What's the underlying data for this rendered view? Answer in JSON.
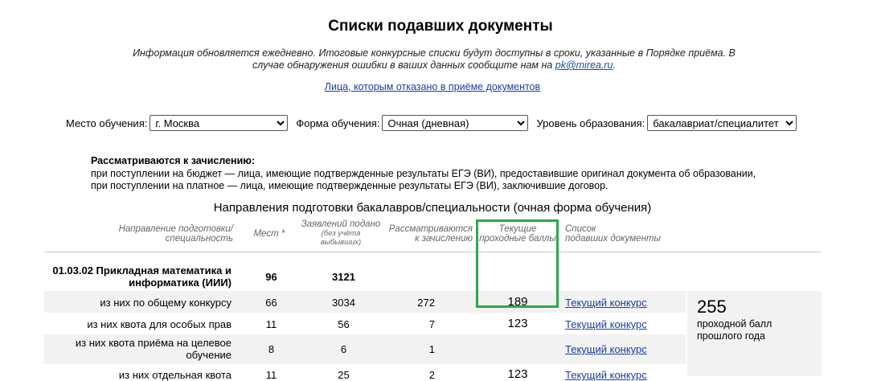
{
  "page": {
    "title": "Списки подавших документы",
    "info_line1": "Информация обновляется ежедневно. Итоговые конкурсные списки будут доступны в сроки, указанные в Порядке приёма. В",
    "info_line2_pre": "случае обнаружения ошибки в ваших данных сообщите нам на ",
    "info_email": "pk@mirea.ru",
    "info_line2_post": ".",
    "rejected_link": "Лица, которым отказано в приёме документов"
  },
  "filters": {
    "place_label": "Место обучения:",
    "place_value": "г. Москва",
    "form_label": "Форма обучения:",
    "form_value": "Очная (дневная)",
    "level_label": "Уровень образования:",
    "level_value": "бакалавриат/специалитет"
  },
  "consider": {
    "heading": "Рассматриваются к зачислению:",
    "line1": "при поступлении на бюджет — лица, имеющие подтвержденные результаты ЕГЭ (ВИ), предоставившие оригинал документа об образовании,",
    "line2": "при поступлении на платное — лица, имеющие подтвержденные результаты ЕГЭ (ВИ), заключившие договор."
  },
  "table": {
    "title": "Направления подготовки бакалавров/специальности (очная форма обучения)",
    "headers": {
      "direction_1": "Направление подготовки/",
      "direction_2": "специальность",
      "places": "Мест *",
      "applications_1": "Заявлений подано",
      "applications_2": "(без учёта",
      "applications_3": "выбывших)",
      "considered_1": "Рассматриваются",
      "considered_2": "к зачислению",
      "passing_1": "Текущие",
      "passing_2": "проходные баллы",
      "list_1": "Список",
      "list_2": "подавших документы"
    },
    "program": {
      "name_1": "01.03.02 Прикладная математика и",
      "name_2": "информатика (ИИИ)",
      "places": "96",
      "applications": "3121"
    },
    "rows": [
      {
        "name": "из них по общему конкурсу",
        "places": "66",
        "applications": "3034",
        "considered": "272",
        "passing": "189",
        "link": "Текущий конкурс"
      },
      {
        "name": "из них квота для особых прав",
        "places": "11",
        "applications": "56",
        "considered": "7",
        "passing": "123",
        "link": "Текущий конкурс"
      },
      {
        "name_1": "из них квота приёма на целевое",
        "name_2": "обучение",
        "places": "8",
        "applications": "6",
        "considered": "1",
        "passing": "",
        "link": "Текущий конкурс"
      },
      {
        "name": "из них отдельная квота",
        "places": "11",
        "applications": "25",
        "considered": "2",
        "passing": "123",
        "link": "Текущий конкурс"
      }
    ],
    "previous": {
      "value": "255",
      "label_1": "проходной балл",
      "label_2": "прошлого года"
    }
  },
  "colors": {
    "highlight": "#2ea84a",
    "link": "#1a3e9e",
    "row_shade": "#f2f2f2"
  }
}
